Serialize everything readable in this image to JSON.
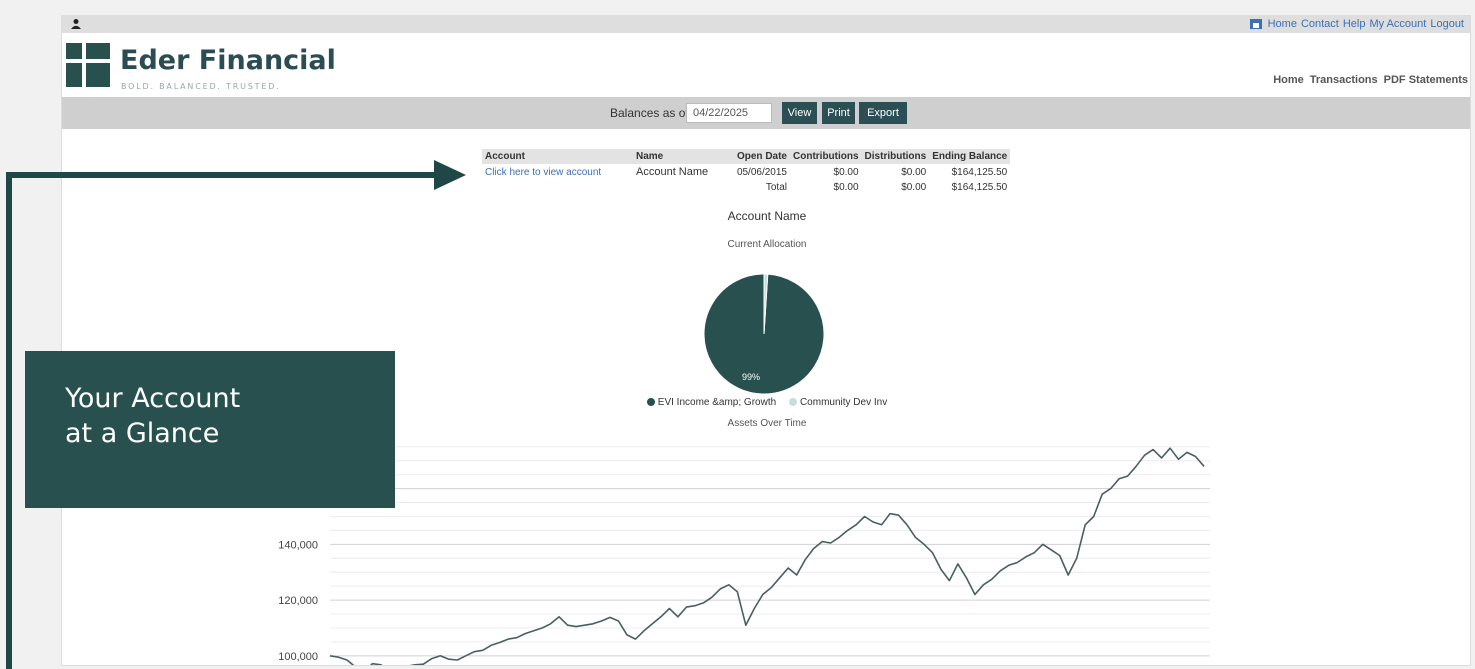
{
  "top_links": [
    "Home",
    "Contact",
    "Help",
    "My Account",
    "Logout"
  ],
  "brand": {
    "name": "Eder Financial",
    "tagline": "BOLD. BALANCED. TRUSTED."
  },
  "main_nav": [
    "Home",
    "Transactions",
    "PDF Statements"
  ],
  "toolbar": {
    "balances_label": "Balances as of",
    "date_value": "04/22/2025",
    "view_label": "View",
    "print_label": "Print",
    "export_label": "Export"
  },
  "table": {
    "headers": [
      "Account",
      "Name",
      "Open Date",
      "Contributions",
      "Distributions",
      "Ending Balance"
    ],
    "row": {
      "account": "Click here to view account",
      "name": "Account Name",
      "open_date": "05/06/2015",
      "contributions": "$0.00",
      "distributions": "$0.00",
      "ending_balance": "$164,125.50"
    },
    "total": {
      "label": "Total",
      "contributions": "$0.00",
      "distributions": "$0.00",
      "ending_balance": "$164,125.50"
    }
  },
  "chart_title": "Account Name",
  "allocation_title": "Current Allocation",
  "assets_title": "Assets Over Time",
  "callout": [
    "Your Account",
    "at a Glance"
  ],
  "colors": {
    "primary": "#28504f",
    "accent_light": "#c9dedb",
    "link": "#3b6fb6"
  },
  "chart_data": [
    {
      "type": "pie",
      "title": "Current Allocation",
      "slices": [
        {
          "name": "EVI Income &amp; Growth",
          "value": 99,
          "color": "#28504f"
        },
        {
          "name": "Community Dev Inv",
          "value": 1,
          "color": "#c9dedb"
        }
      ],
      "data_labels": [
        "99%"
      ],
      "legend": "bottom"
    },
    {
      "type": "line",
      "title": "Assets Over Time",
      "ylim": [
        96000,
        176000
      ],
      "y_ticks": [
        100000,
        120000,
        140000
      ],
      "y_tick_labels": [
        "100,000",
        "120,000",
        "140,000"
      ],
      "grid": true,
      "series": [
        {
          "values": [
            100000,
            99500,
            98500,
            96000,
            94000,
            97200,
            96800,
            94500,
            93800,
            96200,
            96800,
            97000,
            99000,
            100000,
            98800,
            98500,
            100000,
            101500,
            102000,
            103800,
            104800,
            106000,
            106500,
            108000,
            109000,
            110000,
            111500,
            114000,
            111000,
            110500,
            111000,
            111500,
            112500,
            113800,
            112500,
            107500,
            106000,
            109000,
            111500,
            114000,
            117000,
            114000,
            117500,
            118000,
            119000,
            121000,
            124000,
            125500,
            123000,
            111000,
            117000,
            122000,
            124500,
            128000,
            131500,
            129000,
            134500,
            138500,
            141000,
            140500,
            142500,
            145000,
            147000,
            150000,
            148000,
            147000,
            151000,
            150500,
            147000,
            142500,
            140000,
            137000,
            131000,
            127000,
            133000,
            128000,
            122000,
            125500,
            127500,
            130500,
            132500,
            133500,
            135500,
            137000,
            140000,
            138000,
            136000,
            129000,
            135000,
            147000,
            150000,
            158000,
            160000,
            163500,
            164500,
            168000,
            172000,
            174000,
            171000,
            174500,
            170500,
            173000,
            171500,
            168000
          ]
        }
      ]
    }
  ]
}
